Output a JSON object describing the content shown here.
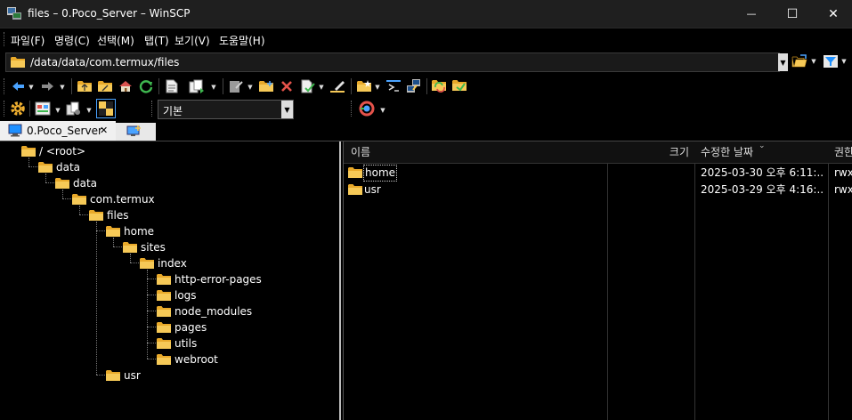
{
  "window": {
    "title": "files – 0.Poco_Server – WinSCP",
    "minimize_glyph": "—",
    "maximize_glyph": "☐",
    "close_glyph": "✕"
  },
  "menu": {
    "items": [
      {
        "label": "파일(F)"
      },
      {
        "label": "명령(C)"
      },
      {
        "label": "선택(M)"
      },
      {
        "label": "탭(T)"
      },
      {
        "label": "보기(V)"
      },
      {
        "label": "도움말(H)"
      }
    ]
  },
  "address": {
    "path": "/data/data/com.termux/files"
  },
  "toolbar": {
    "profile_value": "기본"
  },
  "tabs": {
    "active_label": "0.Poco_Server",
    "close_glyph": "✕"
  },
  "tree": {
    "nodes": [
      {
        "label": "/ <root>"
      },
      {
        "label": "data"
      },
      {
        "label": "data"
      },
      {
        "label": "com.termux"
      },
      {
        "label": "files"
      },
      {
        "label": "home"
      },
      {
        "label": "sites"
      },
      {
        "label": "index"
      },
      {
        "label": "http-error-pages"
      },
      {
        "label": "logs"
      },
      {
        "label": "node_modules"
      },
      {
        "label": "pages"
      },
      {
        "label": "utils"
      },
      {
        "label": "webroot"
      },
      {
        "label": "usr"
      }
    ]
  },
  "file_list": {
    "columns": {
      "name": "이름",
      "size": "크기",
      "modified": "수정한 날짜",
      "rights": "권한"
    },
    "rows": [
      {
        "name": "home",
        "size": "",
        "modified": "2025-03-30 오후 6:11:...",
        "rights": "rwx"
      },
      {
        "name": "usr",
        "size": "",
        "modified": "2025-03-29 오후 4:16:...",
        "rights": "rwx"
      }
    ]
  },
  "colors": {
    "folder": "#f0c14b",
    "accent_blue": "#1e90ff",
    "background": "#000000"
  }
}
